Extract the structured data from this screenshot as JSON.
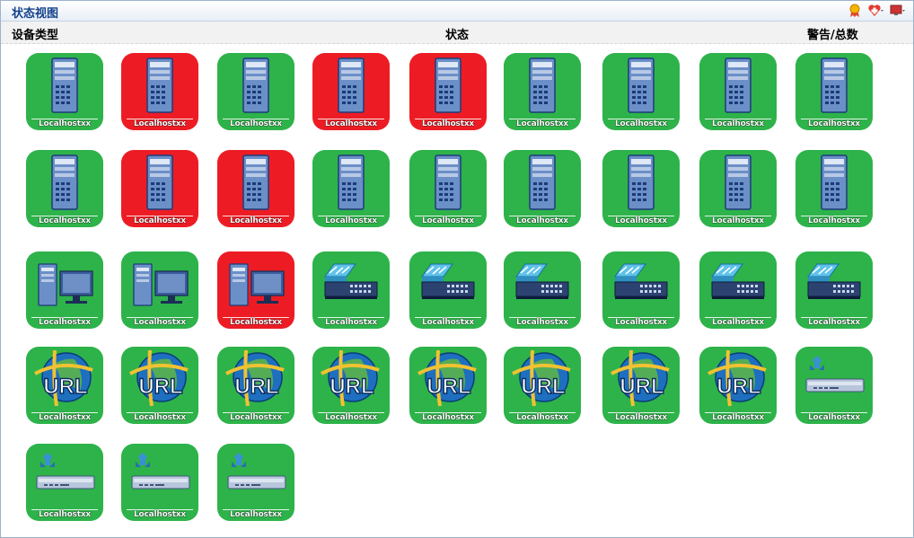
{
  "panel": {
    "title": "状态视图"
  },
  "header": {
    "col_type": "设备类型",
    "col_status": "状态",
    "col_alerts": "警告/总数"
  },
  "toolbar": {
    "icons": [
      "badge-icon",
      "heart-plus-icon",
      "monitor-icon"
    ]
  },
  "colors": {
    "ok": "#2db34a",
    "alert": "#ed1c24"
  },
  "tiles": [
    {
      "label": "Localhostxx",
      "kind": "server",
      "status": "ok"
    },
    {
      "label": "Localhostxx",
      "kind": "server",
      "status": "alert"
    },
    {
      "label": "Localhostxx",
      "kind": "server",
      "status": "ok"
    },
    {
      "label": "Localhostxx",
      "kind": "server",
      "status": "alert"
    },
    {
      "label": "Localhostxx",
      "kind": "server",
      "status": "alert"
    },
    {
      "label": "Localhostxx",
      "kind": "server",
      "status": "ok"
    },
    {
      "label": "Localhostxx",
      "kind": "server",
      "status": "ok"
    },
    {
      "label": "Localhostxx",
      "kind": "server",
      "status": "ok"
    },
    {
      "label": "Localhostxx",
      "kind": "server",
      "status": "ok"
    },
    {
      "label": "Localhostxx",
      "kind": "server",
      "status": "ok"
    },
    {
      "label": "Localhostxx",
      "kind": "server",
      "status": "alert"
    },
    {
      "label": "Localhostxx",
      "kind": "server",
      "status": "alert"
    },
    {
      "label": "Localhostxx",
      "kind": "server",
      "status": "ok"
    },
    {
      "label": "Localhostxx",
      "kind": "server",
      "status": "ok"
    },
    {
      "label": "Localhostxx",
      "kind": "server",
      "status": "ok"
    },
    {
      "label": "Localhostxx",
      "kind": "server",
      "status": "ok"
    },
    {
      "label": "Localhostxx",
      "kind": "server",
      "status": "ok"
    },
    {
      "label": "Localhostxx",
      "kind": "server",
      "status": "ok"
    },
    {
      "label": "Localhostxx",
      "kind": "pc",
      "status": "ok"
    },
    {
      "label": "Localhostxx",
      "kind": "pc",
      "status": "ok"
    },
    {
      "label": "Localhostxx",
      "kind": "pc",
      "status": "alert"
    },
    {
      "label": "Localhostxx",
      "kind": "switch",
      "status": "ok"
    },
    {
      "label": "Localhostxx",
      "kind": "switch",
      "status": "ok"
    },
    {
      "label": "Localhostxx",
      "kind": "switch",
      "status": "ok"
    },
    {
      "label": "Localhostxx",
      "kind": "switch",
      "status": "ok"
    },
    {
      "label": "Localhostxx",
      "kind": "switch",
      "status": "ok"
    },
    {
      "label": "Localhostxx",
      "kind": "switch",
      "status": "ok"
    },
    {
      "label": "Localhostxx",
      "kind": "url",
      "status": "ok",
      "icon_text": "URL"
    },
    {
      "label": "Localhostxx",
      "kind": "url",
      "status": "ok",
      "icon_text": "URL"
    },
    {
      "label": "Localhostxx",
      "kind": "url",
      "status": "ok",
      "icon_text": "URL"
    },
    {
      "label": "Localhostxx",
      "kind": "url",
      "status": "ok",
      "icon_text": "URL"
    },
    {
      "label": "Localhostxx",
      "kind": "url",
      "status": "ok",
      "icon_text": "URL"
    },
    {
      "label": "Localhostxx",
      "kind": "url",
      "status": "ok",
      "icon_text": "URL"
    },
    {
      "label": "Localhostxx",
      "kind": "url",
      "status": "ok",
      "icon_text": "URL"
    },
    {
      "label": "Localhostxx",
      "kind": "url",
      "status": "ok",
      "icon_text": "URL"
    },
    {
      "label": "Localhostxx",
      "kind": "router",
      "status": "ok"
    },
    {
      "label": "Localhostxx",
      "kind": "router",
      "status": "ok"
    },
    {
      "label": "Localhostxx",
      "kind": "router",
      "status": "ok"
    },
    {
      "label": "Localhostxx",
      "kind": "router",
      "status": "ok"
    }
  ]
}
